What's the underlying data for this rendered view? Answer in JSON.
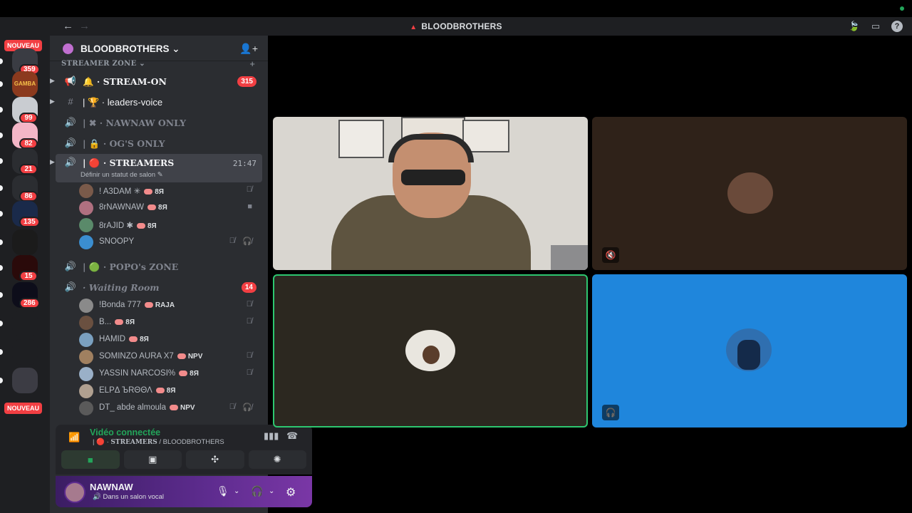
{
  "titlebar": {
    "back": "←",
    "forward": "→",
    "title": "BLOODBROTHERS"
  },
  "rail": {
    "nouveau_top": "NOUVEAU",
    "nouveau_bottom": "NOUVEAU",
    "servers": [
      {
        "badge": "359",
        "color": "#3a3c43"
      },
      {
        "badge": "",
        "color": "#8b3a1e",
        "label": "GAMBA"
      },
      {
        "badge": "99",
        "color": "#c9ccd1"
      },
      {
        "badge": "82",
        "color": "#f4b6c7"
      },
      {
        "badge": "21",
        "color": "#2b2d31"
      },
      {
        "badge": "86",
        "color": "#2b2d31"
      },
      {
        "badge": "135",
        "color": "#1a2a4a"
      },
      {
        "badge": "",
        "color": "#1b1b1b"
      },
      {
        "badge": "15",
        "color": "#2a0a0a"
      },
      {
        "badge": "286",
        "color": "#0d0d1a"
      },
      {
        "badge": "",
        "color": "#1e1f22"
      },
      {
        "badge": "",
        "color": "#1e1f22"
      },
      {
        "badge": "",
        "color": "#3c3c44"
      }
    ]
  },
  "server": {
    "name": "BLOODBROTHERS",
    "category": "STREAMER ZONE"
  },
  "channels": [
    {
      "name": "STREAM-ON",
      "prefix": "🔔 ·",
      "badge": "315",
      "bright": true
    },
    {
      "name": "leaders-voice",
      "prefix": "| 🏆 ·",
      "bright": true,
      "sans": true
    },
    {
      "name": "NAWNAW ONLY",
      "prefix": "| ✖ ·"
    },
    {
      "name": "OG'S ONLY",
      "prefix": "| 🔒 ·"
    },
    {
      "name": "STREAMERS",
      "prefix": "| 🔴 ·",
      "time": "21:47",
      "status": "Définir un statut de salon"
    },
    {
      "name": "POPO's ZONE",
      "prefix": "| 🟢 ·"
    },
    {
      "name": "Waiting Room",
      "prefix": "· ",
      "badge": "14"
    }
  ],
  "streamers_users": [
    {
      "name": "! A3DAM ✳",
      "tag": "8Я",
      "icon": "mute"
    },
    {
      "name": "8rNAWNAW",
      "tag": "8Я",
      "icon": "cam"
    },
    {
      "name": "8rAJID ✱",
      "tag": "8Я",
      "icon": ""
    },
    {
      "name": "SNOOPY",
      "tag": "",
      "icon": "mute-deaf"
    }
  ],
  "waiting_users": [
    {
      "name": "!Bonda 777",
      "tag": "RAJA",
      "icon": "mute"
    },
    {
      "name": "B...",
      "tag": "8Я",
      "icon": "mute"
    },
    {
      "name": "HAMID",
      "tag": "8Я",
      "icon": ""
    },
    {
      "name": "SOMINZO AURA X7",
      "tag": "NPV",
      "icon": "mute"
    },
    {
      "name": "YASSIN NARCOSI%",
      "tag": "8Я",
      "icon": "mute"
    },
    {
      "name": "ELPΔ ЪRΘΘΛ",
      "tag": "8Я",
      "icon": ""
    },
    {
      "name": "DT_ abde almoula",
      "tag": "NPV",
      "icon": "mute-deaf"
    }
  ],
  "voice": {
    "status": "Vidéo connectée",
    "channel": "STREAMERS",
    "server": "BLOODBROTHERS",
    "separator": " / "
  },
  "me": {
    "name": "NAWNAW",
    "status": "Dans un salon vocal"
  },
  "colors": {
    "accent_green": "#23a55a",
    "badge_red": "#f23f43",
    "tile_blue": "#1f86dc"
  }
}
